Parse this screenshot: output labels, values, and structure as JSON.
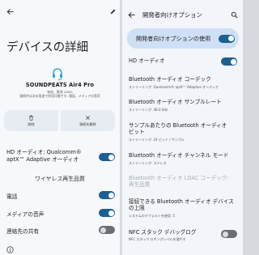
{
  "left": {
    "page_title": "デバイスの詳細",
    "device_name": "SOUNDPEATS Air4 Pro",
    "device_status_line1": "有効、電池 100%",
    "device_status_line2": "接続中は次の用途で利用可能です: 電話、メディアの音声",
    "delete_label": "削除",
    "disconnect_label": "接続を解除",
    "hd_audio_line1": "HD オーディオ: Qualcomm®",
    "hd_audio_line2": "aptX™ Adaptive オーディオ",
    "hd_audio_on": true,
    "codec_header": "ワイヤレス再生品質",
    "call_label": "電話",
    "call_on": true,
    "media_label": "メディアの音声",
    "media_on": true,
    "contacts_label": "連絡先の共有",
    "contacts_on": false
  },
  "right": {
    "title": "開発者向けオプション",
    "master_label": "開発者向けオプションの使用",
    "master_on": true,
    "hd_audio_label": "HD オーディオ",
    "hd_audio_on": true,
    "codec_title": "Bluetooth オーディオ コーデック",
    "codec_sub": "ストリーミング: Qualcomm® aptX™ Adaptive オーディオ",
    "sample_title": "Bluetooth オーディオ サンプルレート",
    "sample_sub": "ストリーミング: 48.0 kHz",
    "bits_title_line1": "サンプルあたりの Bluetooth オーディオ",
    "bits_title_line2": "ビット",
    "bits_sub": "ストリーミング: 24 ビット / サンプル",
    "channel_title": "Bluetooth オーディオ チャンネル モード",
    "channel_sub": "ストリーミング: ステレオ",
    "ldac_line1": "Bluetooth オーディオ LDAC コーデック:",
    "ldac_line2": "再生品質",
    "maxdev_line1": "接続できる Bluetooth オーディオ デバイス",
    "maxdev_line2": "の上限",
    "maxdev_sub": "システムのデフォルトを使用: 5",
    "nfc_title": "NFC スタック デバッグログ",
    "nfc_sub": "NFC スタック ロギングレベルを増やす",
    "nfc_on": false
  },
  "icons": {
    "back": "arrow-left-icon",
    "edit": "pencil-icon",
    "headset": "headset-icon",
    "delete": "trash-icon",
    "disconnect": "close-icon",
    "info": "info-icon"
  },
  "colors": {
    "toggle_on": "#1d5f93",
    "toggle_off": "#6a6e74",
    "master_card": "#cfe0f6",
    "headset_accent": "#2aa7c9"
  }
}
